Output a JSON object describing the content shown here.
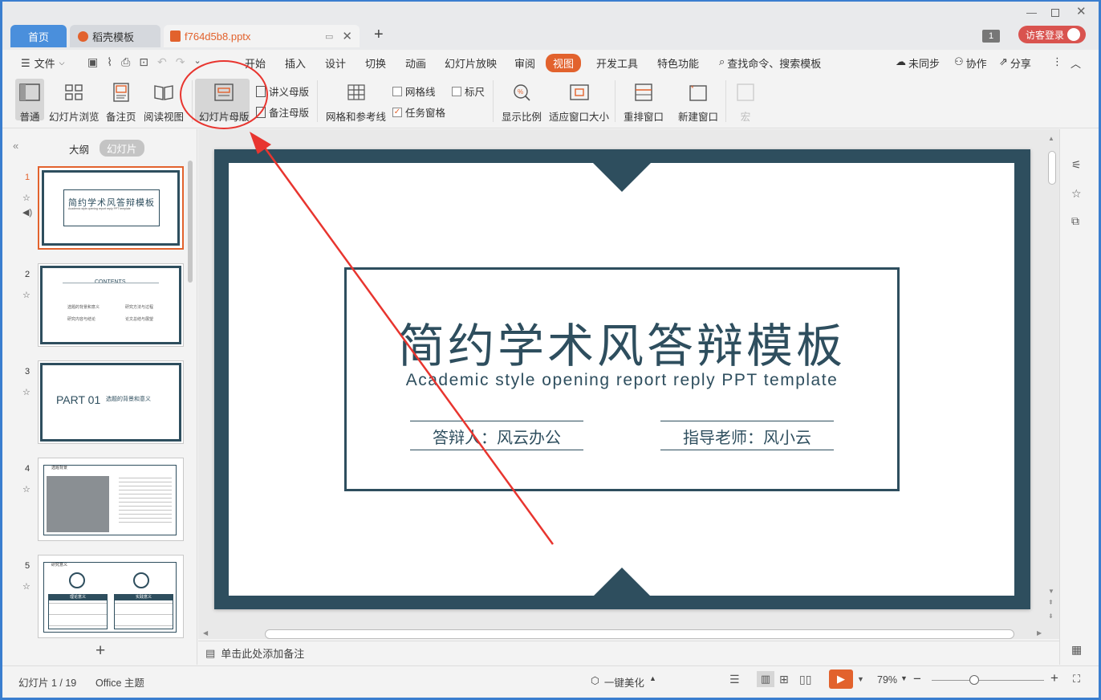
{
  "tabs": {
    "home": "首页",
    "docer": "稻壳模板",
    "file": "f764d5b8.pptx"
  },
  "window": {
    "badge": "1",
    "login": "访客登录"
  },
  "menu": {
    "file": "文件",
    "items": [
      "开始",
      "插入",
      "设计",
      "切换",
      "动画",
      "幻灯片放映",
      "审阅",
      "视图",
      "开发工具",
      "特色功能"
    ],
    "active": "视图",
    "search": "查找命令、搜索模板",
    "sync": "未同步",
    "collab": "协作",
    "share": "分享"
  },
  "ribbon": {
    "normal": "普通",
    "slide_browse": "幻灯片浏览",
    "notes_page": "备注页",
    "reading_view": "阅读视图",
    "slide_master": "幻灯片母版",
    "handout_master": "讲义母版",
    "notes_master": "备注母版",
    "grid_guides": "网格和参考线",
    "gridlines": "网格线",
    "ruler": "标尺",
    "task_pane": "任务窗格",
    "zoom": "显示比例",
    "fit_window": "适应窗口大小",
    "arrange": "重排窗口",
    "new_window": "新建窗口",
    "macro": "宏"
  },
  "panel": {
    "outline": "大纲",
    "slides": "幻灯片"
  },
  "thumbs": {
    "t1_title": "简约学术风答辩模板",
    "t1_sub": "Academic style opening report reply PPT template",
    "t2_title": "CONTENTS",
    "t2_items": [
      "选题的背景和意义",
      "研究方法与过程",
      "研究内容与结论",
      "论文总结与展望"
    ],
    "t3_part": "PART 01",
    "t3_title": "选题的背景和意义",
    "t4_title": "选题背景",
    "t5_title": "研究意义",
    "t5_box1": "理论意义",
    "t5_box2": "实践意义"
  },
  "slide_numbers": [
    "1",
    "2",
    "3",
    "4",
    "5"
  ],
  "slide": {
    "title": "简约学术风答辩模板",
    "subtitle": "Academic style opening report reply PPT template",
    "presenter": "答辩人：风云办公",
    "advisor": "指导老师：风小云"
  },
  "notes_placeholder": "单击此处添加备注",
  "status": {
    "slide_count": "幻灯片 1 / 19",
    "theme": "Office 主题",
    "beautify": "一键美化",
    "zoom": "79%"
  },
  "colors": {
    "accent": "#e2622d",
    "slide_dark": "#2e4e5e",
    "annotation": "#e8352f",
    "window_blue": "#3a7ecf"
  }
}
